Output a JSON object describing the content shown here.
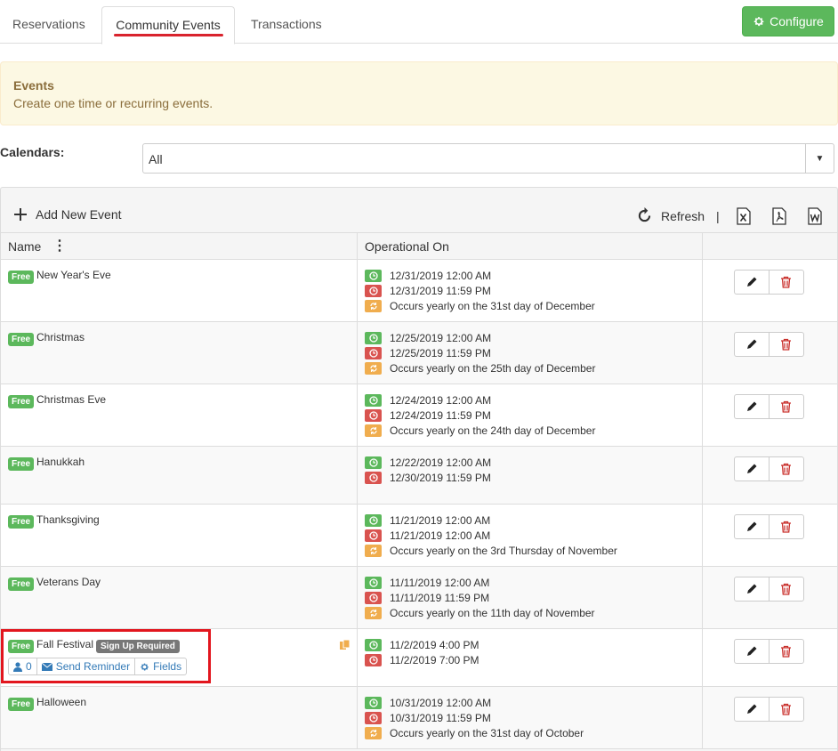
{
  "tabs": [
    {
      "label": "Reservations"
    },
    {
      "label": "Community Events"
    },
    {
      "label": "Transactions"
    }
  ],
  "configure_label": "Configure",
  "info": {
    "title": "Events",
    "subtitle": "Create one time or recurring events."
  },
  "calendars": {
    "label": "Calendars:",
    "value": "All"
  },
  "toolbar": {
    "add_label": "Add New Event",
    "refresh_label": "Refresh",
    "separator": "|"
  },
  "columns": {
    "name": "Name",
    "operational": "Operational On"
  },
  "free_label": "Free",
  "events": [
    {
      "name": "New Year's Eve",
      "start": "12/31/2019 12:00 AM",
      "end": "12/31/2019 11:59 PM",
      "recur": "Occurs yearly on the 31st day of December"
    },
    {
      "name": "Christmas",
      "start": "12/25/2019 12:00 AM",
      "end": "12/25/2019 11:59 PM",
      "recur": "Occurs yearly on the 25th day of December"
    },
    {
      "name": "Christmas Eve",
      "start": "12/24/2019 12:00 AM",
      "end": "12/24/2019 11:59 PM",
      "recur": "Occurs yearly on the 24th day of December"
    },
    {
      "name": "Hanukkah",
      "start": "12/22/2019 12:00 AM",
      "end": "12/30/2019 11:59 PM"
    },
    {
      "name": "Thanksgiving",
      "start": "11/21/2019 12:00 AM",
      "end": "11/21/2019 12:00 AM",
      "recur": "Occurs yearly on the 3rd Thursday of November"
    },
    {
      "name": "Veterans Day",
      "start": "11/11/2019 12:00 AM",
      "end": "11/11/2019 11:59 PM",
      "recur": "Occurs yearly on the 11th day of November"
    },
    {
      "name": "Fall Festival",
      "signup_label": "Sign Up Required",
      "start": "11/2/2019 4:00 PM",
      "end": "11/2/2019 7:00 PM",
      "attendees": "0",
      "reminder_label": "Send Reminder",
      "fields_label": "Fields"
    },
    {
      "name": "Halloween",
      "start": "10/31/2019 12:00 AM",
      "end": "10/31/2019 11:59 PM",
      "recur": "Occurs yearly on the 31st day of October"
    }
  ],
  "colors": {
    "green": "#5cb85c",
    "red": "#d9534f",
    "orange": "#f0ad4e",
    "highlight": "#e2161e"
  },
  "icons": [
    "gear-icon",
    "plus-icon",
    "refresh-icon",
    "excel-icon",
    "pdf-icon",
    "word-icon",
    "clock-icon",
    "alarm-icon",
    "repeat-icon",
    "pencil-icon",
    "trash-icon",
    "user-icon",
    "envelope-icon",
    "copy-icon"
  ]
}
